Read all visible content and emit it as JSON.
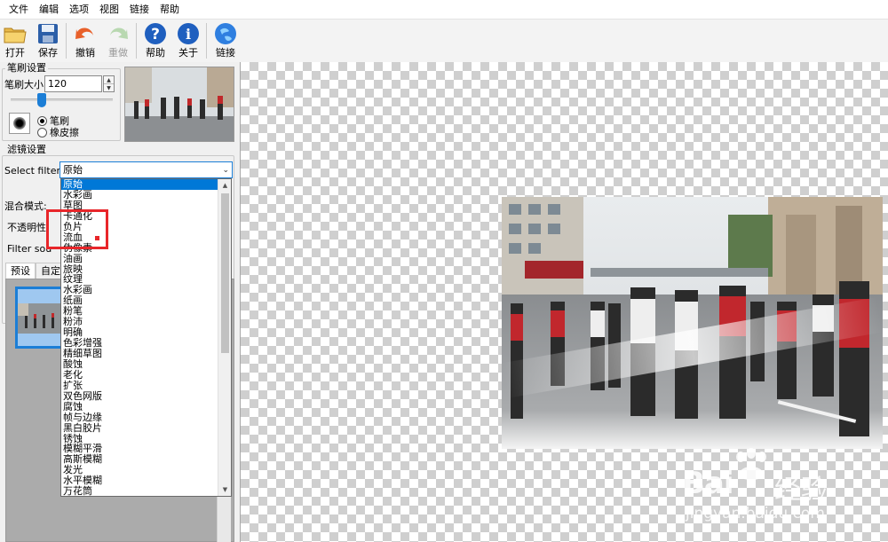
{
  "menu": [
    "文件",
    "编辑",
    "选项",
    "视图",
    "链接",
    "帮助"
  ],
  "toolbar": [
    {
      "name": "open",
      "label": "打开",
      "icon": "folder-icon",
      "enabled": true
    },
    {
      "name": "save",
      "label": "保存",
      "icon": "floppy-icon",
      "enabled": true
    },
    {
      "name": "undo",
      "label": "撤销",
      "icon": "undo-icon",
      "enabled": true
    },
    {
      "name": "redo",
      "label": "重做",
      "icon": "redo-icon",
      "enabled": false
    },
    {
      "name": "help",
      "label": "帮助",
      "icon": "question-icon",
      "enabled": true
    },
    {
      "name": "about",
      "label": "关于",
      "icon": "info-icon",
      "enabled": true
    },
    {
      "name": "link",
      "label": "链接",
      "icon": "globe-icon",
      "enabled": true
    }
  ],
  "brush": {
    "title": "笔刷设置",
    "size_label": "笔刷大小:",
    "size_value": "120",
    "size_fraction": 0.3,
    "radio_brush": "笔刷",
    "radio_eraser": "橡皮擦",
    "selected": "brush"
  },
  "filter": {
    "title": "滤镜设置",
    "select_label": "Select filter:",
    "selected": "原始",
    "blend_label": "混合模式:",
    "opacity_label": "不透明性",
    "source_label": "Filter sou",
    "tabs": [
      "预设",
      "自定"
    ],
    "options": [
      "原始",
      "水彩画",
      "草图",
      "卡通化",
      "负片",
      "流血",
      "伪像素",
      "油画",
      "旅映",
      "纹理",
      "水彩画",
      "纸画",
      "粉笔",
      "粉沛",
      "明确",
      "色彩增强",
      "精细草图",
      "酸蚀",
      "老化",
      "扩张",
      "双色网版",
      "腐蚀",
      "帧与边缘",
      "黑白胶片",
      "锈蚀",
      "模糊平滑",
      "高斯模糊",
      "发光",
      "水平模糊",
      "万花筒"
    ]
  },
  "watermark": {
    "brand": "Bai",
    "brand2": "经验",
    "url": "jingyan.baidu.com"
  },
  "colors": {
    "accent": "#1c7ed6",
    "selection": "#0078d7",
    "highlight_box": "#e8262a"
  }
}
